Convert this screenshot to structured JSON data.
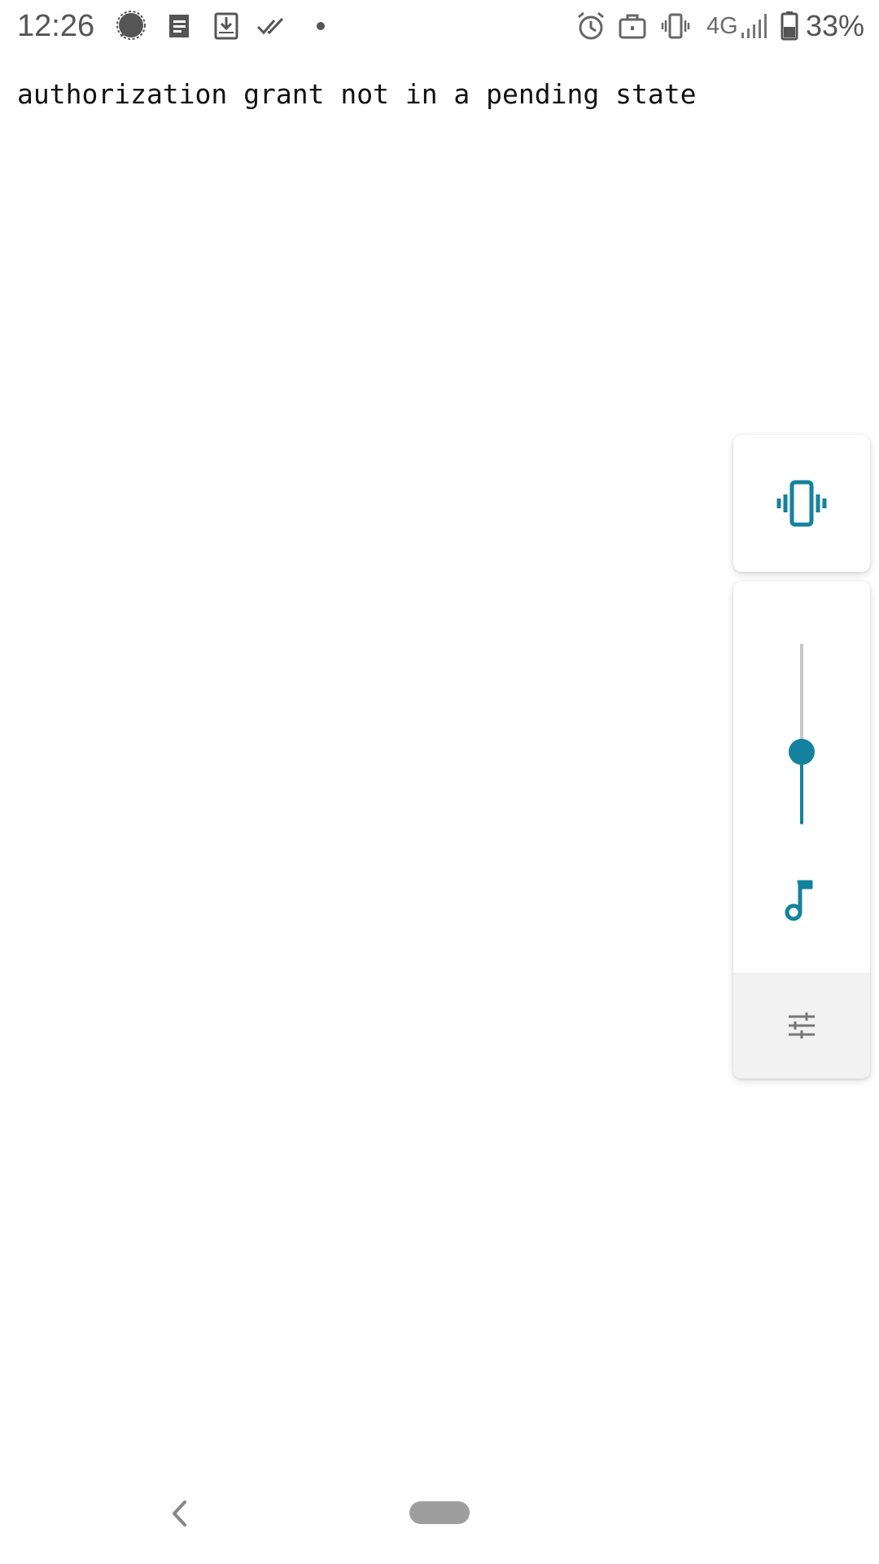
{
  "status_bar": {
    "time": "12:26",
    "notification_icons": [
      "signal-messenger-icon",
      "document-icon",
      "download-icon",
      "double-check-icon",
      "more-dot-icon"
    ],
    "system_icons": [
      "alarm-icon",
      "work-profile-icon",
      "vibrate-icon",
      "cell-signal-icon",
      "battery-icon"
    ],
    "network": "4G",
    "battery": "33%"
  },
  "content": {
    "message": "authorization grant not in a pending state"
  },
  "volume_panel": {
    "ringer_mode": "vibrate",
    "stream": "media",
    "level_fraction": 0.4,
    "accent_color": "#14829f"
  },
  "navigation": {
    "icons": [
      "back-icon",
      "home-pill"
    ]
  }
}
